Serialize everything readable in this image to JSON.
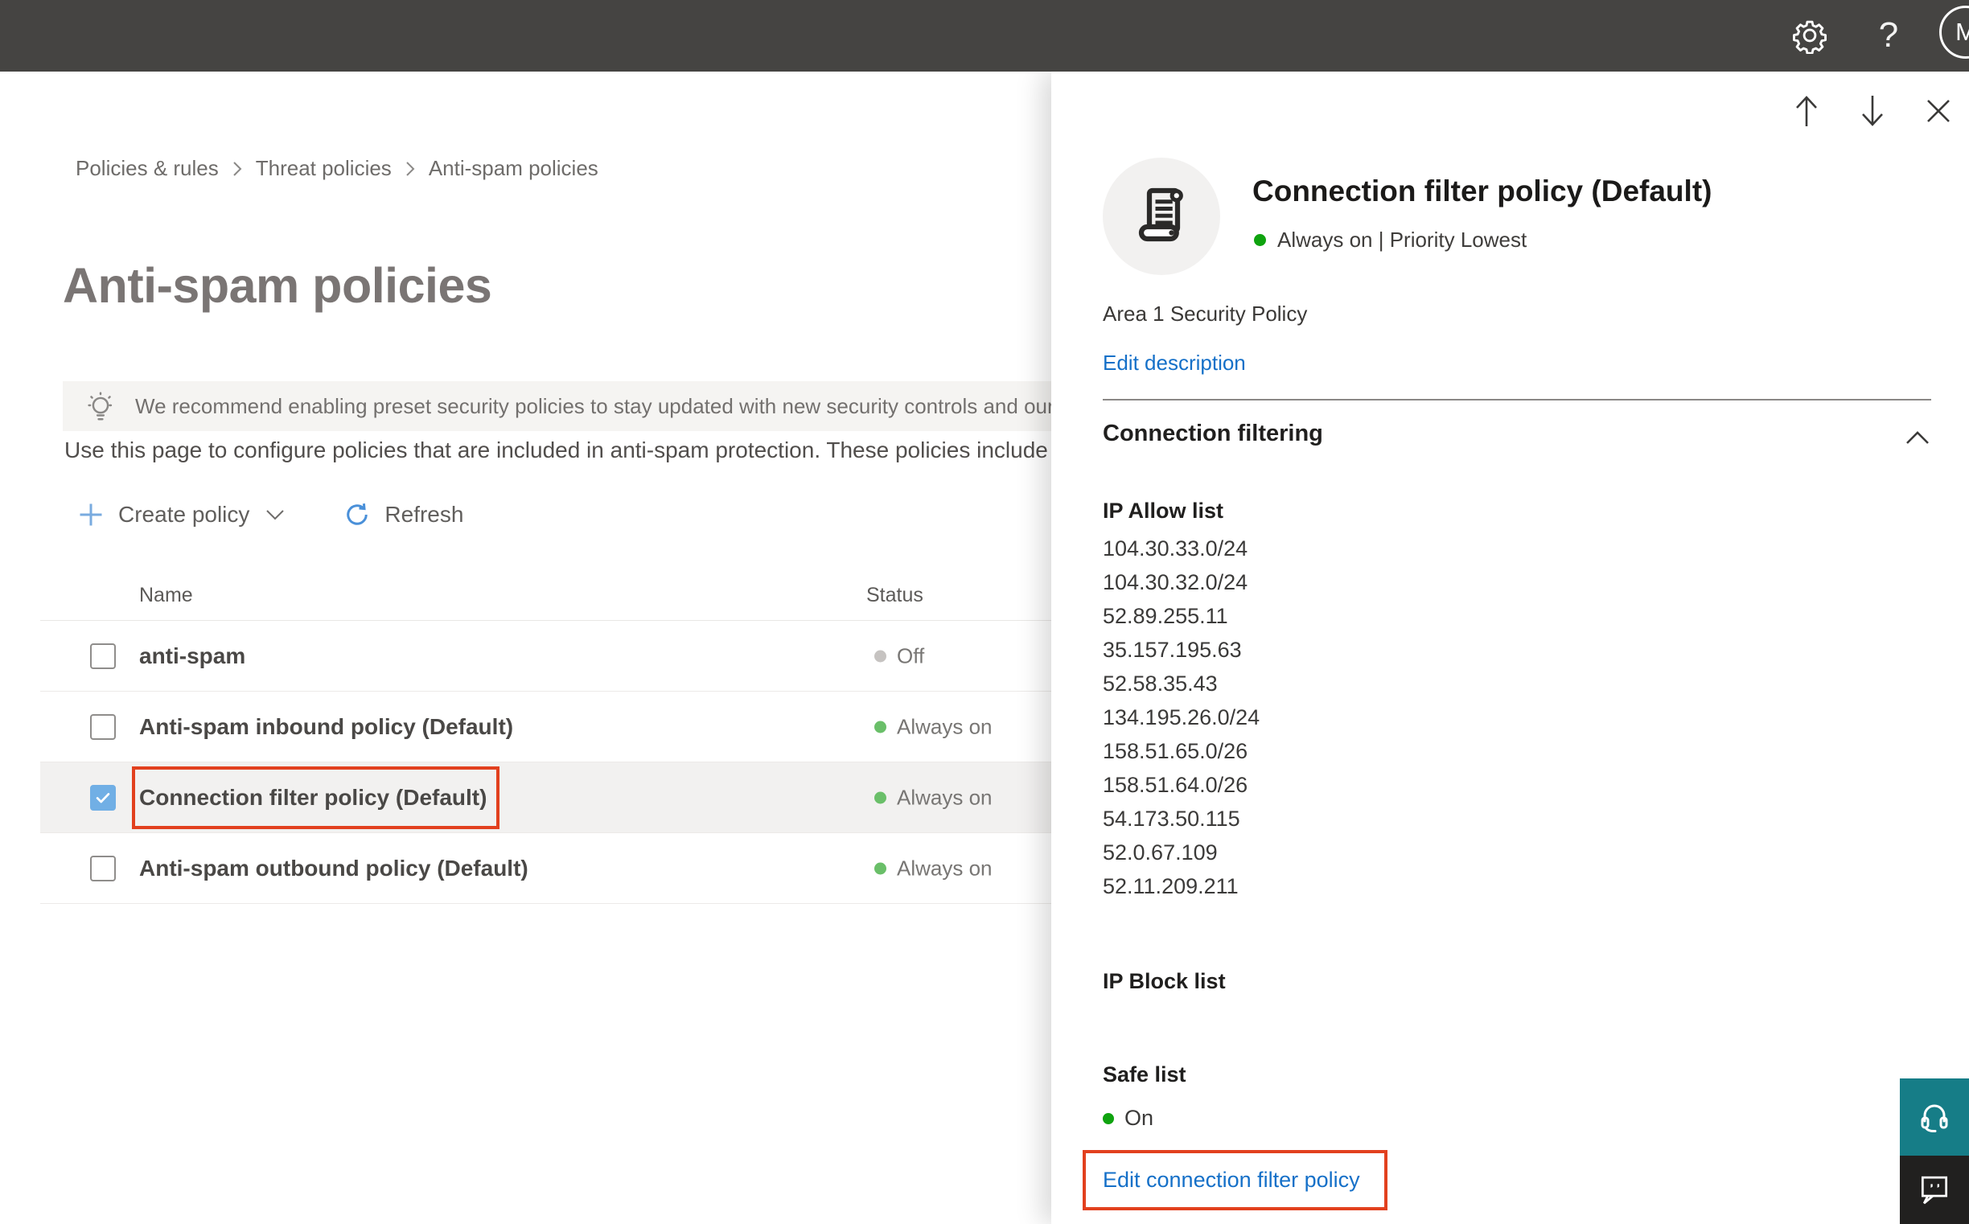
{
  "topbar": {
    "help_label": "?",
    "avatar_initial": "M"
  },
  "breadcrumb": {
    "items": [
      "Policies & rules",
      "Threat policies",
      "Anti-spam policies"
    ]
  },
  "page": {
    "title": "Anti-spam policies",
    "banner_text": "We recommend enabling preset security policies to stay updated with new security controls and our recomme",
    "description": "Use this page to configure policies that are included in anti-spam protection. These policies include"
  },
  "toolbar": {
    "create_label": "Create policy",
    "refresh_label": "Refresh"
  },
  "table": {
    "columns": [
      "Name",
      "Status"
    ],
    "rows": [
      {
        "name": "anti-spam",
        "status": "Off",
        "checked": false,
        "selected": false,
        "highlight": false
      },
      {
        "name": "Anti-spam inbound policy (Default)",
        "status": "Always on",
        "checked": false,
        "selected": false,
        "highlight": false
      },
      {
        "name": "Connection filter policy (Default)",
        "status": "Always on",
        "checked": true,
        "selected": true,
        "highlight": true
      },
      {
        "name": "Anti-spam outbound policy (Default)",
        "status": "Always on",
        "checked": false,
        "selected": false,
        "highlight": false
      }
    ]
  },
  "panel": {
    "title": "Connection filter policy (Default)",
    "status_line": "Always on | Priority Lowest",
    "description": "Area 1 Security Policy",
    "edit_description_label": "Edit description",
    "section_title": "Connection filtering",
    "ip_allow_title": "IP Allow list",
    "ip_allow_items": [
      "104.30.33.0/24",
      "104.30.32.0/24",
      "52.89.255.11",
      "35.157.195.63",
      "52.58.35.43",
      "134.195.26.0/24",
      "158.51.65.0/26",
      "158.51.64.0/26",
      "54.173.50.115",
      "52.0.67.109",
      "52.11.209.211"
    ],
    "ip_block_title": "IP Block list",
    "safe_list_title": "Safe list",
    "safe_list_status": "On",
    "edit_link_label": "Edit connection filter policy"
  },
  "icons": {
    "gear-icon": "gear",
    "help-icon": "question-mark",
    "lightbulb-icon": "lightbulb",
    "plus-icon": "plus",
    "refresh-icon": "circular-arrow",
    "chevron-down-icon": "chevron-down",
    "chevron-up-icon": "chevron-up",
    "chevron-right-icon": "chevron-right",
    "arrow-up-icon": "arrow-up",
    "arrow-down-icon": "arrow-down",
    "close-icon": "x",
    "scroll-policy-icon": "scroll-document",
    "checkmark-icon": "check",
    "headset-icon": "headset",
    "chat-feedback-icon": "speech-bubble"
  },
  "colors": {
    "topbar_bg": "#454442",
    "accent_blue": "#1570c8",
    "toolbar_plus_blue": "#79abdf",
    "toolbar_refresh_blue": "#4a90d9",
    "checkbox_blue": "#71afe5",
    "highlight_red": "#e2401e",
    "status_on_green_table": "#6abf69",
    "status_on_green_panel": "#0fa30f",
    "status_off_gray": "#c6c3c1",
    "selected_row_bg": "#f2f1f0",
    "banner_bg": "#f5f4f2",
    "teal_support": "#167d87",
    "chat_button_bg": "#21201f"
  }
}
